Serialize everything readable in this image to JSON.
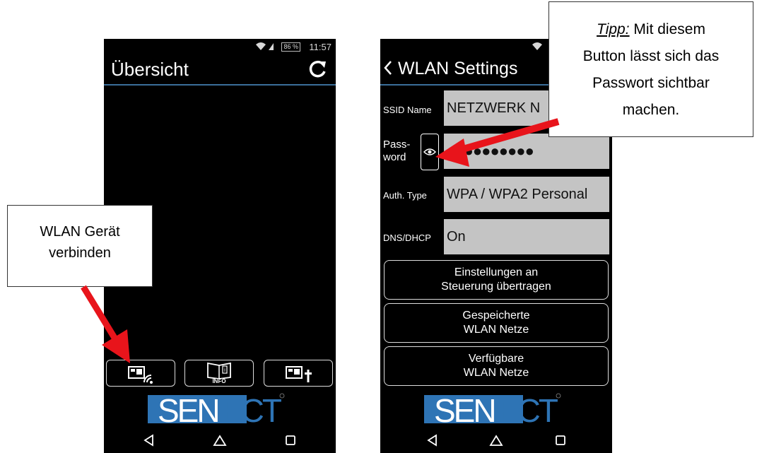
{
  "left_screen": {
    "status": {
      "battery": "86 %",
      "time": "11:57"
    },
    "title": "Übersicht",
    "bottom_buttons": [
      {
        "icon": "wlan-device-icon"
      },
      {
        "icon": "info-book-icon",
        "label": "INFO"
      },
      {
        "icon": "add-device-icon"
      }
    ],
    "logo": "SENECT",
    "nav": [
      "back-icon",
      "home-icon",
      "recents-icon"
    ]
  },
  "right_screen": {
    "title": "WLAN Settings",
    "back_glyph": "<",
    "rows": [
      {
        "label": "SSID Name",
        "value": "NETZWERK N"
      },
      {
        "label": "Pass-",
        "label2": "word",
        "value": "●●●●●●●●●●"
      },
      {
        "label": "Auth. Type",
        "value": "WPA / WPA2 Personal"
      },
      {
        "label": "DNS/DHCP",
        "value": "On"
      }
    ],
    "buttons": [
      {
        "line1": "Einstellungen an",
        "line2": "Steuerung übertragen"
      },
      {
        "line1": "Gespeicherte",
        "line2": "WLAN Netze"
      },
      {
        "line1": "Verfügbare",
        "line2": "WLAN Netze"
      }
    ],
    "logo": "SENECT"
  },
  "callouts": {
    "left": {
      "line1": "WLAN Gerät",
      "line2": "verbinden"
    },
    "right": {
      "tipp": "Tipp:",
      "line1_rest": " Mit diesem",
      "line2": "Button lässt sich das",
      "line3": "Passwort sichtbar",
      "line4": "machen."
    }
  },
  "colors": {
    "phone_bg": "#000000",
    "divider": "#3a6e9a",
    "field_bg": "#c4c4c4",
    "arrow": "#e8141b",
    "logo_blue": "#2e74b5"
  }
}
